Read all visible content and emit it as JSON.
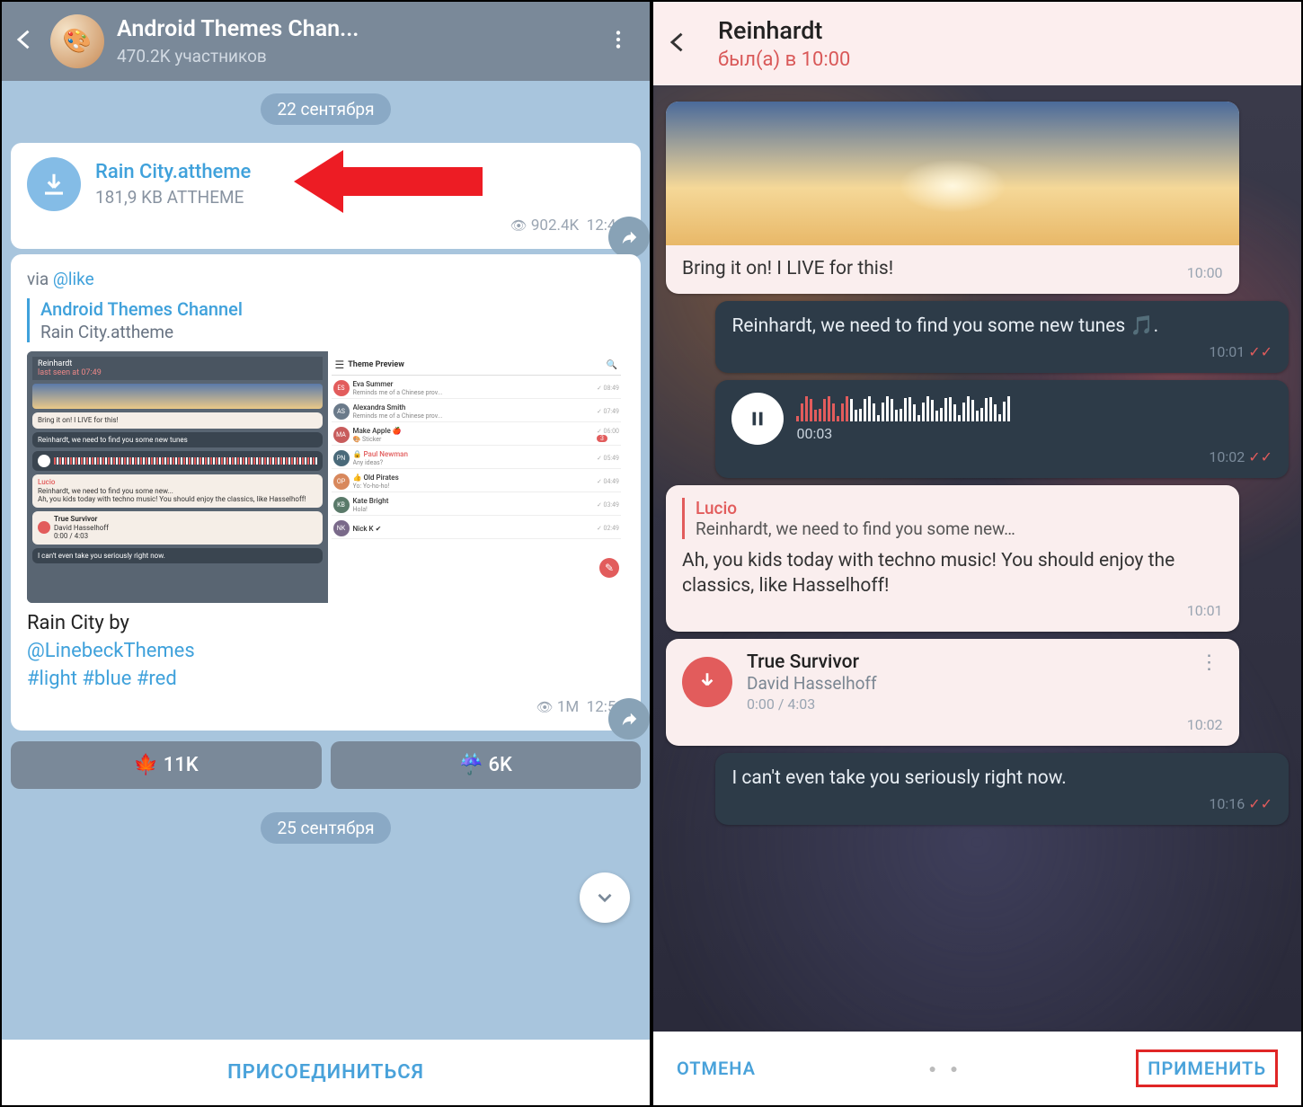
{
  "left": {
    "header": {
      "title": "Android Themes Chan...",
      "subtitle": "470.2K участников"
    },
    "date1": "22 сентября",
    "file": {
      "name": "Rain City.attheme",
      "meta": "181,9 KB ATTHEME",
      "views": "902.4K",
      "time": "12:49"
    },
    "post": {
      "via_prefix": "via ",
      "via_handle": "@like",
      "quote_title": "Android Themes Channel",
      "quote_sub": "Rain City.attheme",
      "caption_line1": "Rain City by",
      "caption_author": "@LinebeckThemes",
      "caption_tags": "#light #blue #red",
      "views": "1M",
      "time": "12:50"
    },
    "reactions": {
      "a": "🍁 11K",
      "b": "☔ 6K"
    },
    "date2": "25 сентября",
    "footer": "ПРИСОЕДИНИТЬСЯ",
    "preview": {
      "left_header_name": "Reinhardt",
      "left_header_seen": "last seen at 07:49",
      "right_header": "Theme Preview",
      "m1": "Bring it on! I LIVE for this!",
      "m2": "Reinhardt, we need to find you some new tunes",
      "m3_name": "Lucio",
      "m3a": "Reinhardt, we need to find you some new...",
      "m3b": "Ah, you kids today with techno music! You should enjoy the classics, like Hasselhoff!",
      "m4_title": "True Survivor",
      "m4_artist": "David Hasselhoff",
      "m4_dur": "0:00 / 4:03",
      "m5": "I can't even take you seriously right now.",
      "chats": [
        {
          "av": "ES",
          "c": "#e25c5c",
          "name": "Eva Summer",
          "msg": "Reminds me of a Chinese prov...",
          "time": "08:49"
        },
        {
          "av": "AS",
          "c": "#6a7a8a",
          "name": "Alexandra Smith",
          "msg": "Reminds me of a Chinese prov...",
          "time": "07:49"
        },
        {
          "av": "MA",
          "c": "#c85c5c",
          "name": "Make Apple 🍎",
          "msg": "🎨 Sticker",
          "time": "06:00",
          "badge": "3"
        },
        {
          "av": "PN",
          "c": "#4a6a7a",
          "name": "🔒 Paul Newman",
          "msg": "Any ideas?",
          "time": "05:49",
          "red": true
        },
        {
          "av": "OP",
          "c": "#d8885c",
          "name": "👍 Old Pirates",
          "msg": "Yo: Yo-ho-ho!",
          "time": "04:49"
        },
        {
          "av": "KB",
          "c": "#5a7a6a",
          "name": "Kate Bright",
          "msg": "Hola!",
          "time": "03:49"
        },
        {
          "av": "NK",
          "c": "#7a6a8a",
          "name": "Nick K ✔",
          "msg": "",
          "time": "02:49"
        }
      ]
    }
  },
  "right": {
    "header": {
      "title": "Reinhardt",
      "subtitle": "был(а) в 10:00"
    },
    "m1": {
      "text": "Bring it on! I LIVE for this!",
      "time": "10:00"
    },
    "m2": {
      "text": "Reinhardt, we need to find you some new tunes 🎵.",
      "time": "10:01"
    },
    "voice": {
      "elapsed": "00:03",
      "time": "10:02"
    },
    "m3": {
      "quote_name": "Lucio",
      "quote_text": "Reinhardt, we need to find you some new…",
      "text": "Ah, you kids today with techno music! You should enjoy the classics, like Hasselhoff!",
      "time": "10:01"
    },
    "song": {
      "title": "True Survivor",
      "artist": "David Hasselhoff",
      "duration": "0:00 / 4:03",
      "time": "10:02"
    },
    "m4": {
      "text": "I can't even take you seriously right now.",
      "time": "10:16"
    },
    "footer": {
      "cancel": "ОТМЕНА",
      "apply": "ПРИМЕНИТЬ"
    }
  }
}
